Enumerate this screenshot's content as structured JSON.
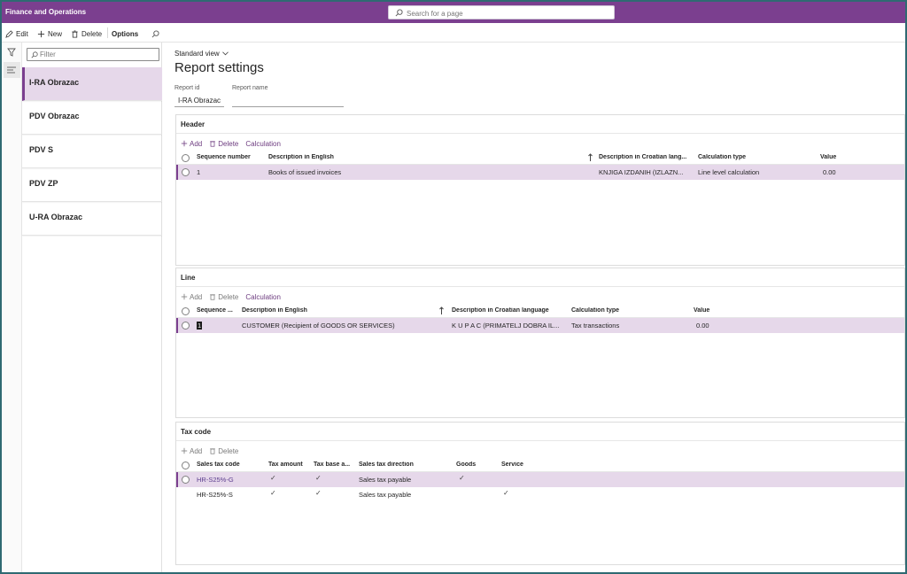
{
  "app": {
    "title": "Finance and Operations",
    "search_placeholder": "Search for a page"
  },
  "actions": {
    "edit": "Edit",
    "new": "New",
    "delete": "Delete",
    "options": "Options"
  },
  "list": {
    "filter_placeholder": "Filter",
    "items": [
      {
        "label": "I-RA Obrazac",
        "selected": true
      },
      {
        "label": "PDV Obrazac"
      },
      {
        "label": "PDV S"
      },
      {
        "label": "PDV ZP"
      },
      {
        "label": "U-RA Obrazac"
      }
    ]
  },
  "main": {
    "view": "Standard view",
    "title": "Report settings",
    "report_id_label": "Report id",
    "report_id_value": "I-RA Obrazac",
    "report_name_label": "Report name",
    "report_name_value": ""
  },
  "header_section": {
    "title": "Header",
    "toolbar": {
      "add": "Add",
      "delete": "Delete",
      "calculation": "Calculation"
    },
    "columns": [
      "Sequence number",
      "Description in English",
      "Description in Croatian lang...",
      "Calculation type",
      "Value"
    ],
    "rows": [
      [
        "1",
        "Books of issued invoices",
        "KNJIGA IZDANIH (IZLAZN...",
        "Line level calculation",
        "0.00"
      ]
    ]
  },
  "line_section": {
    "title": "Line",
    "toolbar": {
      "add": "Add",
      "delete": "Delete",
      "calculation": "Calculation"
    },
    "columns": [
      "Sequence ...",
      "Description in English",
      "Description in Croatian language",
      "Calculation type",
      "Value"
    ],
    "rows": [
      [
        "1",
        "CUSTOMER (Recipient of GOODS OR SERVICES)",
        "K U P A C (PRIMATELJ DOBRA IL...",
        "Tax transactions",
        "0.00"
      ]
    ]
  },
  "taxcode_section": {
    "title": "Tax code",
    "toolbar": {
      "add": "Add",
      "delete": "Delete"
    },
    "columns": [
      "Sales tax code",
      "Tax amount",
      "Tax base a...",
      "Sales tax direction",
      "Goods",
      "Service"
    ],
    "rows": [
      {
        "code": "HR-S25%-G",
        "direction": "Sales tax payable",
        "tax_amount": true,
        "tax_base": true,
        "goods": true,
        "service": false
      },
      {
        "code": "HR-S25%-S",
        "direction": "Sales tax payable",
        "tax_amount": true,
        "tax_base": true,
        "goods": false,
        "service": true
      }
    ]
  },
  "colors": {
    "brand": "#7b3f8f",
    "selection": "#e6d8ea",
    "link": "#5d3f8f"
  }
}
